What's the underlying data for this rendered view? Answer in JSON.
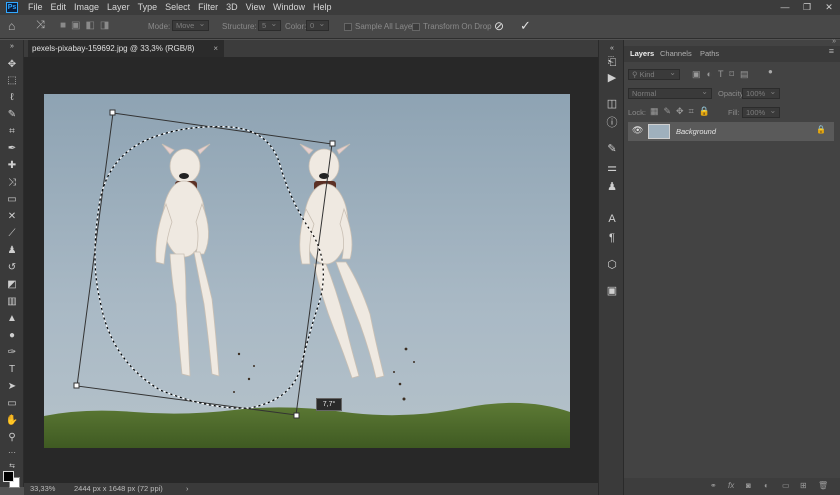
{
  "menubar": {
    "logo": "Ps",
    "items": [
      "File",
      "Edit",
      "Image",
      "Layer",
      "Type",
      "Select",
      "Filter",
      "3D",
      "View",
      "Window",
      "Help"
    ],
    "window_controls": [
      "—",
      "❐",
      "✕"
    ]
  },
  "options_bar": {
    "mode_label": "Mode:",
    "mode_value": "Move",
    "structure_label": "Structure:",
    "structure_value": "5",
    "color_label": "Color:",
    "color_value": "0",
    "sample_all_layers": "Sample All Layers",
    "transform_on_drop": "Transform On Drop",
    "cancel_icon": "⃠",
    "commit_icon": "✓"
  },
  "document": {
    "tab_title": "pexels-pixabay-159692.jpg @ 33,3% (RGB/8)",
    "close": "×",
    "angle_readout": "7,7°"
  },
  "status": {
    "zoom": "33,33%",
    "info": "2444 px x 1648 px (72 ppi)",
    "arrow": "›"
  },
  "panels": {
    "tabs": [
      "Layers",
      "Channels",
      "Paths"
    ],
    "filter_kind": "Kind",
    "blend_mode": "Normal",
    "opacity_label": "Opacity:",
    "opacity_value": "100%",
    "lock_label": "Lock:",
    "fill_label": "Fill:",
    "fill_value": "100%",
    "layer_name": "Background"
  },
  "colors": {
    "menubar": "#3c3c3c",
    "canvas_bg": "#282828",
    "accent": "#31a8ff",
    "selected_layer": "#5a5a5a"
  }
}
